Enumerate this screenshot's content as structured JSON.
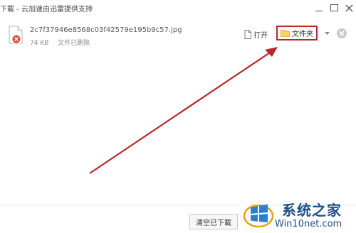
{
  "window": {
    "title": "下載 - 云加速由迅雷提供支持"
  },
  "download": {
    "file_name": "2c7f37946e8568c03f42579e195b9c57.jpg",
    "file_size": "74 KB",
    "status": "文件已删除",
    "open_label": "打开",
    "folder_label": "文件夹"
  },
  "footer": {
    "clear_label": "清空已下載"
  },
  "watermark": {
    "title": "系统之家",
    "url": "Win10net.com"
  },
  "colors": {
    "highlight_border": "#b8282b",
    "arrow": "#b8282b",
    "delete_badge": "#d94c3b",
    "watermark": "#1f4f8a"
  },
  "icons": {
    "file": "image-file-icon",
    "deleted_badge": "deleted-badge-icon",
    "open": "document-icon",
    "folder": "folder-icon",
    "dropdown": "chevron-down-icon",
    "remove": "remove-circle-icon",
    "minimize": "minimize-icon",
    "maximize": "maximize-icon",
    "close": "close-icon"
  }
}
